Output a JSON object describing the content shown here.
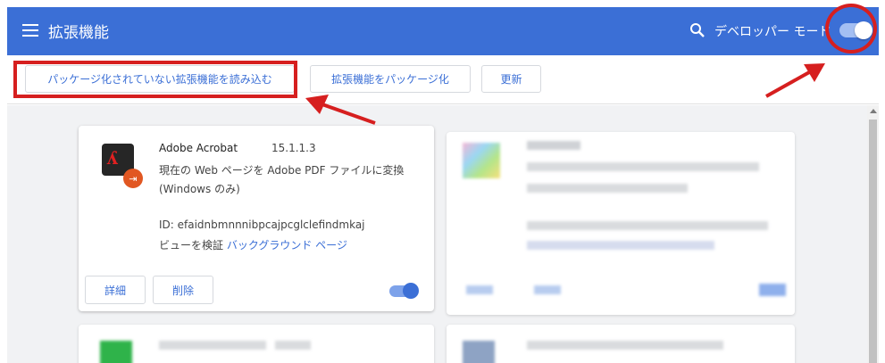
{
  "header": {
    "title": "拡張機能",
    "dev_mode_label": "デベロッパー モード",
    "dev_mode_enabled": true,
    "accent_color": "#3b6fd6"
  },
  "toolbar": {
    "load_unpacked_label": "パッケージ化されていない拡張機能を読み込む",
    "pack_label": "拡張機能をパッケージ化",
    "update_label": "更新"
  },
  "extension": {
    "name": "Adobe Acrobat",
    "version": "15.1.1.3",
    "description": "現在の Web ページを Adobe PDF ファイルに変換 (Windows のみ)",
    "id_text": "ID: efaidnbmnnnibpcajpcglclefindmkaj",
    "inspect_prefix": "ビューを検証",
    "inspect_link": "バックグラウンド ページ",
    "details_label": "詳細",
    "remove_label": "削除",
    "enabled": true,
    "icon": "adobe-acrobat-icon"
  },
  "annotations": {
    "color": "#d61f1f"
  }
}
